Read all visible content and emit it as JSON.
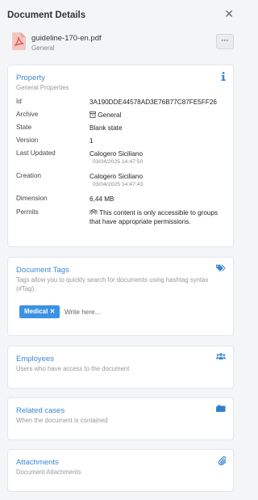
{
  "header": {
    "title": "Document Details",
    "close_glyph": "✕"
  },
  "file": {
    "name": "guideline-170-en.pdf",
    "category": "General",
    "icon": "pdf-file-icon",
    "more_label": "···"
  },
  "property": {
    "title": "Property",
    "subtitle": "General Properties",
    "icon": "info-icon",
    "rows": [
      {
        "label": "Id",
        "value": "3A190DDE44578AD3E76B77C87FE5FF26"
      },
      {
        "label": "Archive",
        "value": "General",
        "icon": "archive-icon"
      },
      {
        "label": "State",
        "value": "Blank state"
      },
      {
        "label": "Version",
        "value": "1"
      },
      {
        "label": "Last Updated",
        "value": "Calogero Siciliano",
        "stamp": "03/04/2025 14:47:50"
      },
      {
        "label": "Creation",
        "value": "Calogero Siciliano",
        "stamp": "03/04/2025 14:47:43"
      },
      {
        "label": "Dimension",
        "value": "6,44 MB"
      },
      {
        "label": "Permits",
        "value": "This content is only accessible to groups that have appropriate permissions.",
        "icon": "group-icon"
      }
    ]
  },
  "tags": {
    "title": "Document Tags",
    "subtitle": "Tags allow you to quickly search for documents using hashtag syntax (#Tag).",
    "icon": "tags-icon",
    "chip": "Medical",
    "chip_remove": "✕",
    "input_placeholder": "Write here..."
  },
  "employees": {
    "title": "Employees",
    "subtitle": "Users who have access to the document",
    "icon": "users-icon"
  },
  "related": {
    "title": "Related cases",
    "subtitle": "When the document is contained",
    "icon": "folder-icon"
  },
  "attachments": {
    "title": "Attachments",
    "subtitle": "Document Attachments",
    "icon": "paperclip-icon"
  },
  "colors": {
    "accent": "#3a87d6",
    "chip": "#3b92e4",
    "pdf": "#e05a4f"
  }
}
